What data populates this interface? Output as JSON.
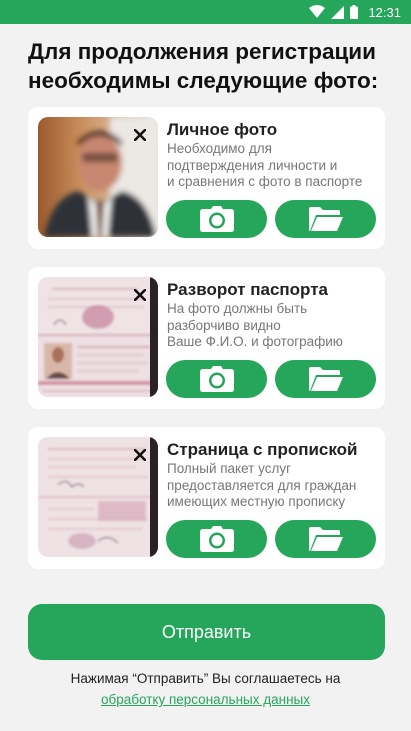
{
  "status_bar": {
    "time": "12:31"
  },
  "page_title_line1": "Для продолжения регистрации",
  "page_title_line2": "необходимы следующие фото:",
  "cards": [
    {
      "title": "Личное фото",
      "desc": [
        "Необходимо для",
        "подтверждения личности и",
        "и сравнения с фото в паспорте"
      ]
    },
    {
      "title": "Разворот паспорта",
      "desc": [
        "На фото должны быть",
        "разборчиво видно",
        "Ваше Ф.И.О. и фотографию"
      ]
    },
    {
      "title": "Страница с пропиской",
      "desc": [
        "Полный пакет услуг",
        "предоставляется для граждан",
        "имеющих местную прописку"
      ]
    }
  ],
  "submit_label": "Отправить",
  "consent_text": "Нажимая “Отправить” Вы соглашаетесь на",
  "consent_link": "обработку персональных данных",
  "colors": {
    "accent": "#25a65a",
    "background": "#f2f2f2"
  },
  "icons": [
    "wifi-icon",
    "signal-icon",
    "battery-icon",
    "close-icon",
    "camera-icon",
    "folder-icon"
  ]
}
